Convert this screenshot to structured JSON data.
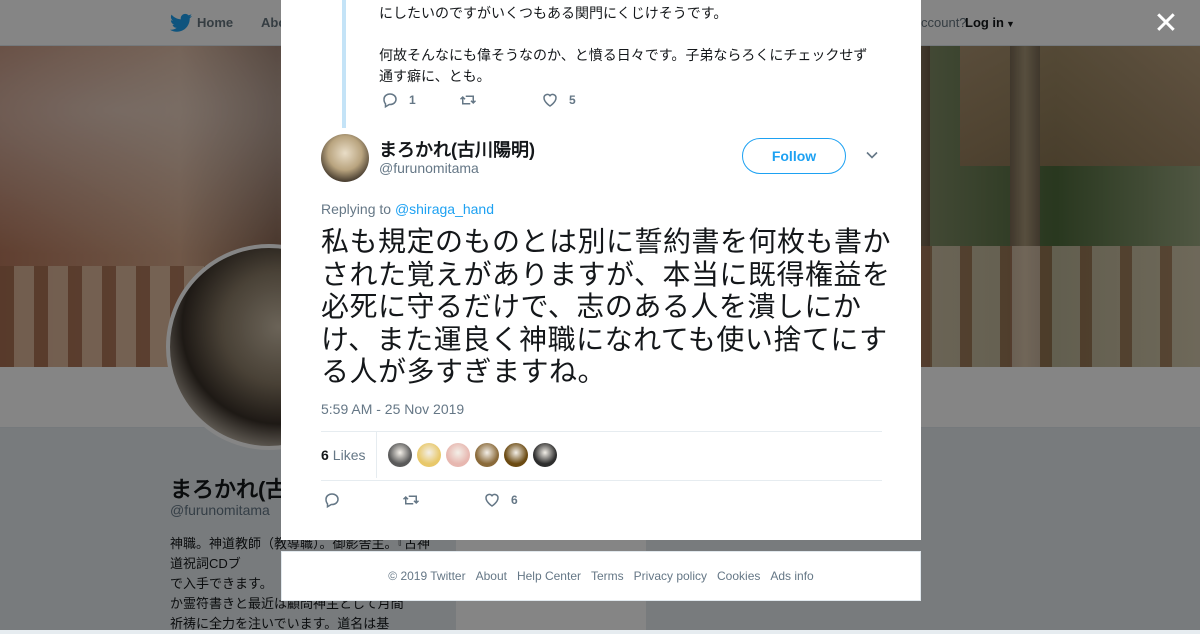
{
  "nav": {
    "home_label": "Home",
    "about_label": "Abo",
    "account_prompt": "ccount?",
    "login_label": "Log in"
  },
  "profile": {
    "name": "まろかれ(古",
    "handle": "@furunomitama",
    "bio": "神職。神道教師（教導職）。御影舎主。『古神道祝詞CDブ\nで入手できます。\nか霊符書きと最近は顧問神主として月間\n祈祷に全力を注いでいます。道名は基"
  },
  "parent_tweet": {
    "text_line1": "にしたいのですがいくつもある関門にくじけそうです。",
    "text_line2": "何故そんなにも偉そうなのか、と憤る日々です。子弟ならろくにチェックせず\n通す癖に、とも。",
    "reply_count": "1",
    "retweet_count": "",
    "like_count": "5"
  },
  "tweet": {
    "author_name": "まろかれ(古川陽明)",
    "author_handle": "@furunomitama",
    "follow_label": "Follow",
    "replying_prefix": "Replying to ",
    "replying_to": "@shiraga_hand",
    "text": "私も規定のものとは別に誓約書を何枚も書かされた覚えがありますが、本当に既得権益を必死に守るだけで、志のある人を潰しにかけ、また運良く神職になれても使い捨てにする人が多すぎますね。",
    "timestamp": "5:59 AM - 25 Nov 2019",
    "likes_number": "6",
    "likes_label": "Likes",
    "reply_count": "",
    "retweet_count": "",
    "like_count": "6"
  },
  "likers": [
    {
      "color": "#5a5a5a",
      "icon": "avatar"
    },
    {
      "color": "#e8c86a",
      "icon": "avatar"
    },
    {
      "color": "#e7b7b0",
      "icon": "avatar"
    },
    {
      "color": "#8a6a3a",
      "icon": "avatar"
    },
    {
      "color": "#6b4a12",
      "icon": "avatar"
    },
    {
      "color": "#2d2d2d",
      "icon": "avatar"
    }
  ],
  "footer": {
    "copyright": "© 2019 Twitter",
    "about": "About",
    "help": "Help Center",
    "terms": "Terms",
    "privacy": "Privacy policy",
    "cookies": "Cookies",
    "ads": "Ads info"
  },
  "colors": {
    "accent": "#1da1f2",
    "thread_line": "#c4e3f7",
    "muted_text": "#657786"
  }
}
